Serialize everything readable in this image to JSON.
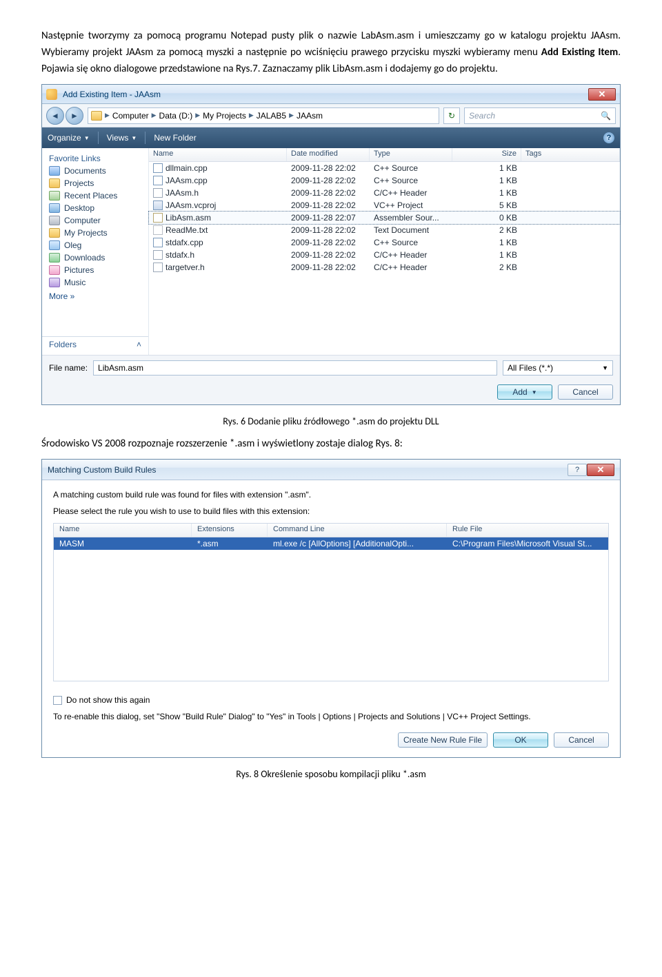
{
  "para1_a": "Następnie tworzymy za pomocą programu Notepad pusty plik o nazwie LabAsm.asm i umieszczamy go w katalogu projektu JAAsm. Wybieramy projekt JAAsm za pomocą myszki a następnie po wciśnięciu prawego przycisku myszki wybieramy menu ",
  "para1_bold": "Add Existing Item",
  "para1_b": ". Pojawia się okno dialogowe przedstawione na Rys.7. Zaznaczamy plik LibAsm.asm i dodajemy go do projektu.",
  "caption1": "Rys. 6 Dodanie pliku źródłowego *.asm do projektu DLL",
  "para2": "Środowisko VS 2008 rozpoznaje rozszerzenie *.asm i wyświetlony zostaje dialog Rys. 8:",
  "caption2": "Rys. 8 Określenie sposobu kompilacji pliku *.asm",
  "addDialog": {
    "title": "Add Existing Item - JAAsm",
    "crumbs": [
      "Computer",
      "Data (D:)",
      "My Projects",
      "JALAB5",
      "JAAsm"
    ],
    "search": "Search",
    "toolbar": {
      "organize": "Organize",
      "views": "Views",
      "newFolder": "New Folder"
    },
    "sidebarTitle": "Favorite Links",
    "favorites": [
      "Documents",
      "Projects",
      "Recent Places",
      "Desktop",
      "Computer",
      "My Projects",
      "Oleg",
      "Downloads",
      "Pictures",
      "Music"
    ],
    "more": "More  »",
    "foldersLabel": "Folders",
    "columns": {
      "name": "Name",
      "date": "Date modified",
      "type": "Type",
      "size": "Size",
      "tags": "Tags"
    },
    "files": [
      {
        "name": "dllmain.cpp",
        "date": "2009-11-28 22:02",
        "type": "C++ Source",
        "size": "1 KB",
        "icon": "fi-cpp"
      },
      {
        "name": "JAAsm.cpp",
        "date": "2009-11-28 22:02",
        "type": "C++ Source",
        "size": "1 KB",
        "icon": "fi-cpp"
      },
      {
        "name": "JAAsm.h",
        "date": "2009-11-28 22:02",
        "type": "C/C++ Header",
        "size": "1 KB",
        "icon": "fi-h"
      },
      {
        "name": "JAAsm.vcproj",
        "date": "2009-11-28 22:02",
        "type": "VC++ Project",
        "size": "5 KB",
        "icon": "fi-proj"
      },
      {
        "name": "LibAsm.asm",
        "date": "2009-11-28 22:07",
        "type": "Assembler Sour...",
        "size": "0 KB",
        "icon": "fi-asm",
        "selected": true
      },
      {
        "name": "ReadMe.txt",
        "date": "2009-11-28 22:02",
        "type": "Text Document",
        "size": "2 KB",
        "icon": "fi-txt"
      },
      {
        "name": "stdafx.cpp",
        "date": "2009-11-28 22:02",
        "type": "C++ Source",
        "size": "1 KB",
        "icon": "fi-cpp"
      },
      {
        "name": "stdafx.h",
        "date": "2009-11-28 22:02",
        "type": "C/C++ Header",
        "size": "1 KB",
        "icon": "fi-h"
      },
      {
        "name": "targetver.h",
        "date": "2009-11-28 22:02",
        "type": "C/C++ Header",
        "size": "2 KB",
        "icon": "fi-h"
      }
    ],
    "fileNameLabel": "File name:",
    "fileNameValue": "LibAsm.asm",
    "filter": "All Files (*.*)",
    "addBtn": "Add",
    "cancelBtn": "Cancel"
  },
  "rulesDialog": {
    "title": "Matching Custom Build Rules",
    "line1": "A matching custom build rule was found for files with extension \".asm\".",
    "line2": "Please select the rule you wish to use to build files with this extension:",
    "columns": {
      "name": "Name",
      "ext": "Extensions",
      "cmd": "Command Line",
      "file": "Rule File"
    },
    "row": {
      "name": "MASM",
      "ext": "*.asm",
      "cmd": "ml.exe /c [AllOptions] [AdditionalOpti...",
      "file": "C:\\Program Files\\Microsoft Visual St..."
    },
    "chkLabel": "Do not show this again",
    "hint": "To re-enable this dialog, set \"Show \"Build Rule\" Dialog\" to \"Yes\" in Tools | Options | Projects and Solutions | VC++ Project Settings.",
    "btnCreate": "Create New Rule File",
    "btnOK": "OK",
    "btnCancel": "Cancel"
  }
}
